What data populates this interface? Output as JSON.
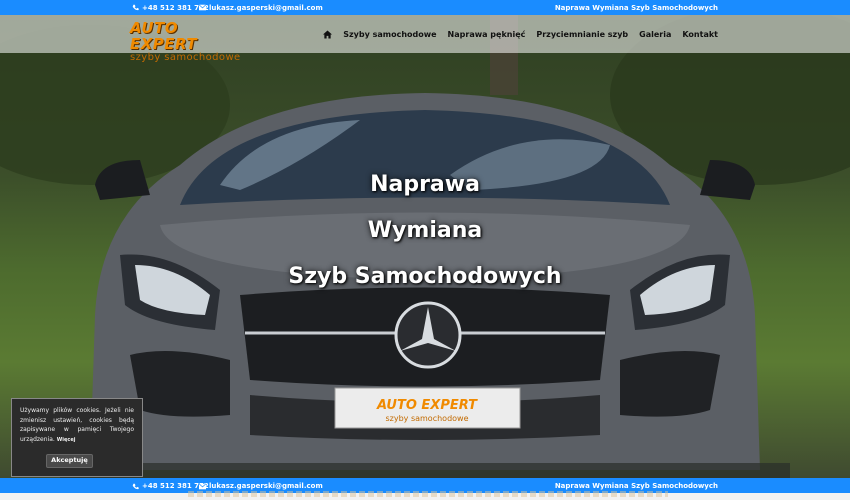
{
  "topbar": {
    "phone": "+48 512 381 752",
    "email": "lukasz.gasperski@gmail.com",
    "tagline": "Naprawa Wymiana Szyb Samochodowych"
  },
  "logo": {
    "line1": "AUTO EXPERT",
    "line2": "szyby samochodowe"
  },
  "nav": {
    "home_icon": "home-icon",
    "items": [
      {
        "label": "Szyby samochodowe"
      },
      {
        "label": "Naprawa pęknięć"
      },
      {
        "label": "Przyciemnianie szyb"
      },
      {
        "label": "Galeria"
      },
      {
        "label": "Kontakt"
      }
    ]
  },
  "hero": {
    "line1": "Naprawa",
    "line2": "Wymiana",
    "line3": "Szyb Samochodowych",
    "plate_line1": "AUTO EXPERT",
    "plate_line2": "szyby samochodowe"
  },
  "cookie": {
    "text": "Używamy plików cookies. Jeżeli nie zmienisz ustawień, cookies będą zapisywane w pamięci Twojego urządzenia.",
    "more": "Więcej",
    "accept": "Akceptuję"
  },
  "colors": {
    "accent": "#1a8cff",
    "logo": "#f08a00"
  }
}
